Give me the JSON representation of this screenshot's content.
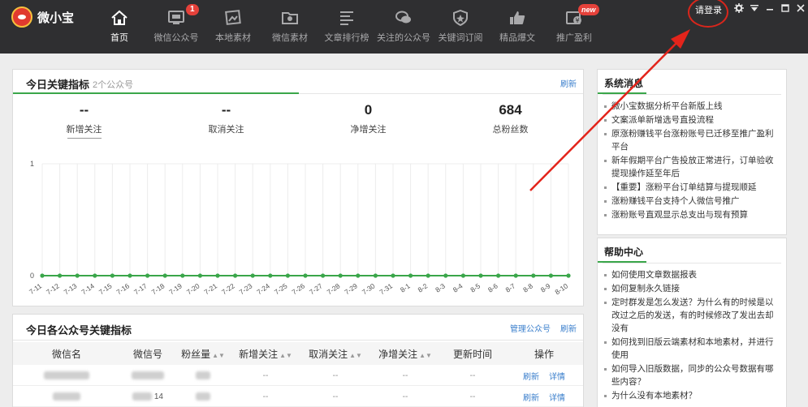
{
  "app": {
    "name": "微小宝"
  },
  "nav": [
    {
      "label": "首页",
      "icon": "home-icon",
      "active": true
    },
    {
      "label": "微信公众号",
      "icon": "monitor-icon",
      "badge": "1"
    },
    {
      "label": "本地素材",
      "icon": "image-icon"
    },
    {
      "label": "微信素材",
      "icon": "folder-icon"
    },
    {
      "label": "文章排行榜",
      "icon": "list-icon"
    },
    {
      "label": "关注的公众号",
      "icon": "chat-icon"
    },
    {
      "label": "关键词订阅",
      "icon": "shield-icon"
    },
    {
      "label": "精品爆文",
      "icon": "thumbs-up-icon"
    },
    {
      "label": "推广盈利",
      "icon": "money-icon",
      "badge": "new"
    }
  ],
  "header": {
    "login": "请登录",
    "controls": [
      "gear-icon",
      "menu-icon",
      "minimize-icon",
      "maximize-icon",
      "close-icon"
    ]
  },
  "today": {
    "title": "今日关键指标",
    "subtitle": "2个公众号",
    "refresh": "刷新",
    "stats": [
      {
        "value": "--",
        "label": "新增关注"
      },
      {
        "value": "--",
        "label": "取消关注"
      },
      {
        "value": "0",
        "label": "净增关注"
      },
      {
        "value": "684",
        "label": "总粉丝数"
      }
    ]
  },
  "chart_data": {
    "type": "line",
    "x": [
      "7-11",
      "7-12",
      "7-13",
      "7-14",
      "7-15",
      "7-16",
      "7-17",
      "7-18",
      "7-19",
      "7-20",
      "7-21",
      "7-22",
      "7-23",
      "7-24",
      "7-25",
      "7-26",
      "7-27",
      "7-28",
      "7-29",
      "7-30",
      "7-31",
      "8-1",
      "8-2",
      "8-3",
      "8-4",
      "8-5",
      "8-6",
      "8-7",
      "8-8",
      "8-9",
      "8-10"
    ],
    "series": [
      {
        "values": [
          0,
          0,
          0,
          0,
          0,
          0,
          0,
          0,
          0,
          0,
          0,
          0,
          0,
          0,
          0,
          0,
          0,
          0,
          0,
          0,
          0,
          0,
          0,
          0,
          0,
          0,
          0,
          0,
          0,
          0,
          0
        ]
      }
    ],
    "ylim": [
      0,
      1
    ],
    "yticks": [
      "0",
      "1"
    ],
    "color": "#3aa64a",
    "grid": true
  },
  "accounts": {
    "title": "今日各公众号关键指标",
    "manage": "管理公众号",
    "refresh": "刷新",
    "columns": [
      "微信名",
      "微信号",
      "粉丝量",
      "新增关注",
      "取消关注",
      "净增关注",
      "更新时间",
      "操作"
    ],
    "rows": [
      {
        "fans_suffix": "",
        "new": "--",
        "cancel": "--",
        "net": "--",
        "updated": "--",
        "refresh": "刷新",
        "detail": "详情"
      },
      {
        "fans_suffix": "14",
        "new": "--",
        "cancel": "--",
        "net": "--",
        "updated": "--",
        "refresh": "刷新",
        "detail": "详情"
      }
    ]
  },
  "system": {
    "title": "系统消息",
    "items": [
      "微小宝数据分析平台新版上线",
      "文案派单新增选号直投流程",
      "原涨粉赚钱平台涨粉账号已迁移至推广盈利平台",
      "新年假期平台广告投放正常进行，订单验收提现操作延至年后",
      "【重要】涨粉平台订单结算与提现顺延",
      "涨粉赚钱平台支持个人微信号推广",
      "涨粉账号直观显示总支出与现有预算"
    ]
  },
  "help": {
    "title": "帮助中心",
    "items": [
      "如何使用文章数据报表",
      "如何复制永久链接",
      "定时群发是怎么发送？为什么有的时候是以改过之后的发送，有的时候修改了发出去却没有",
      "如何找到旧版云端素材和本地素材，并进行使用",
      "如何导入旧版数据，同步的公众号数据有哪些内容？",
      "为什么没有本地素材？"
    ]
  }
}
